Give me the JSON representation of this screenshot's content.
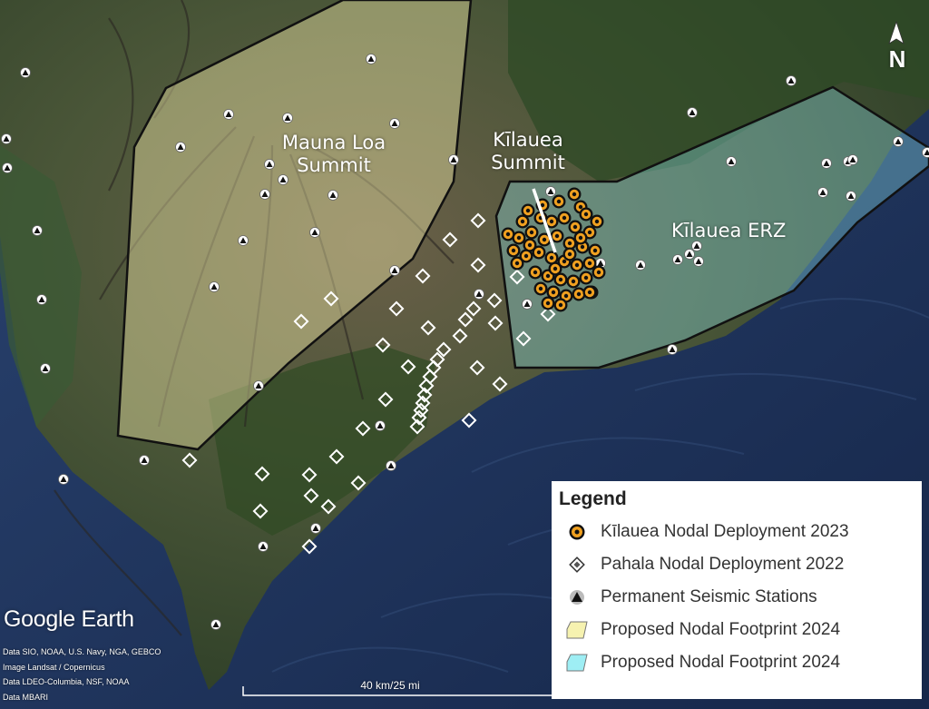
{
  "map": {
    "labels": {
      "mauna_loa": [
        "Mauna Loa",
        "Summit"
      ],
      "kilauea_summit": [
        "Kīlauea",
        "Summit"
      ],
      "kilauea_erz": "Kīlauea ERZ"
    },
    "north_arrow": "N",
    "scale_bar": "40 km/25 mi",
    "logo": "Google Earth",
    "attribution": [
      "Data SIO, NOAA, U.S. Navy, NGA, GEBCO",
      "Image Landsat / Copernicus",
      "Data LDEO-Columbia, NSF, NOAA",
      "Data MBARI"
    ],
    "colors": {
      "footprint_yellow": "#e8e2a4",
      "footprint_cyan": "#8ee4ee",
      "nodal_2023": "#f0a020",
      "ocean": "#1e3158",
      "land": "#3c4a30"
    }
  },
  "legend": {
    "title": "Legend",
    "items": [
      {
        "label": "Kīlauea Nodal Deployment 2023",
        "icon": "orange-ring-icon"
      },
      {
        "label": "Pahala Nodal Deployment 2022",
        "icon": "diamond-icon"
      },
      {
        "label": "Permanent Seismic Stations",
        "icon": "triangle-icon"
      },
      {
        "label": "Proposed Nodal Footprint 2024",
        "icon": "yellow-polygon-icon"
      },
      {
        "label": "Proposed Nodal Footprint 2024",
        "icon": "cyan-polygon-icon"
      }
    ]
  }
}
